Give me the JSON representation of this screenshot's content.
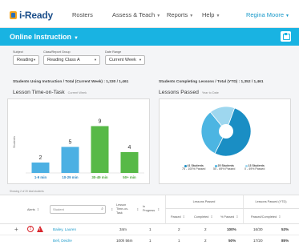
{
  "app": {
    "logo": "i-Ready",
    "nav": [
      {
        "label": "Rosters"
      },
      {
        "label": "Assess & Teach"
      },
      {
        "label": "Reports"
      },
      {
        "label": "Help"
      }
    ],
    "user": "Regina Moore"
  },
  "banner": {
    "title": "Online Instruction"
  },
  "filters": {
    "subject": {
      "label": "Subject",
      "value": "Reading"
    },
    "class": {
      "label": "Class/Report Group",
      "value": "Reading Class A"
    },
    "date": {
      "label": "Date Range",
      "value": "Current Week"
    }
  },
  "stats": {
    "using": "Students Using Instruction / Total (Current Week) : 1,330 / 1,461",
    "completing": "Students Completing Lessons / Total (YTD) : 1,352 / 1,461"
  },
  "time_on_task": {
    "title": "Lesson Time-on-Task",
    "subtitle": "Current Week",
    "ylabel": "Students"
  },
  "lessons_passed": {
    "title": "Lessons Passed",
    "subtitle": "Year to Date",
    "legend": [
      {
        "count": "41 Students",
        "range": "75 - 100% Passed",
        "color": "#1a8ec4"
      },
      {
        "count": "25 Students",
        "range": "50 - 69% Passed",
        "color": "#4cb5e2"
      },
      {
        "count": "13 Students",
        "range": "0 - 49% Passed",
        "color": "#9ed7ef"
      }
    ]
  },
  "chart_data": [
    {
      "type": "bar",
      "title": "Lesson Time-on-Task",
      "ylabel": "Students",
      "categories": [
        "1-9 min",
        "10-29 min",
        "30-49 min",
        "50+ min"
      ],
      "values": [
        2,
        5,
        9,
        4
      ],
      "colors": [
        "#4cb0e3",
        "#4cb0e3",
        "#57b947",
        "#57b947"
      ],
      "ylim": [
        0,
        12
      ]
    },
    {
      "type": "pie",
      "title": "Lessons Passed",
      "categories": [
        "75 - 100% Passed",
        "50 - 69% Passed",
        "0 - 49% Passed"
      ],
      "values": [
        41,
        25,
        13
      ],
      "colors": [
        "#1a8ec4",
        "#4cb5e2",
        "#9ed7ef"
      ]
    }
  ],
  "table": {
    "showing": "Showing 2 of 20 total students",
    "headers": {
      "alerts": "Alerts",
      "search_placeholder": "Student",
      "time_on_task": "Lesson Time-on-Task",
      "in_progress": "In Progress",
      "group_passed": "Lessons Passed",
      "passed": "Passed",
      "completed": "Completed",
      "pct_passed": "% Passed",
      "group_ytd": "Lessons Passed (YTD)",
      "passed_completed": "Passed/Completed"
    },
    "rows": [
      {
        "student": "Bailey, Lauren",
        "time": "34m",
        "in_progress": "1",
        "passed": "2",
        "completed": "2",
        "pct": "100%",
        "ytd": "16/30",
        "ytd_pct": "53%"
      },
      {
        "student": "Bell, Deidre",
        "time": "100h 56m",
        "in_progress": "1",
        "passed": "1",
        "completed": "2",
        "pct": "50%",
        "ytd": "17/20",
        "ytd_pct": "85%"
      }
    ]
  }
}
